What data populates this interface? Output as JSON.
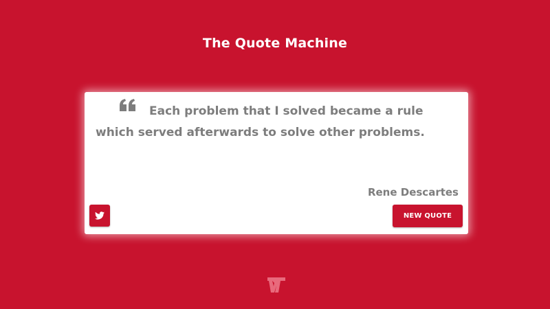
{
  "header": {
    "title": "The Quote Machine"
  },
  "quote": {
    "line1": "Each problem that I solved became a rule",
    "line2": "which served afterwards to solve other problems.",
    "author": "Rene Descartes"
  },
  "actions": {
    "new_quote_label": "NEW QUOTE",
    "tweet_icon": "twitter-icon"
  },
  "footer": {
    "logo_icon": "logo-icon"
  },
  "colors": {
    "background": "#c8132e",
    "card": "#ffffff",
    "text": "#7d7d7d"
  }
}
